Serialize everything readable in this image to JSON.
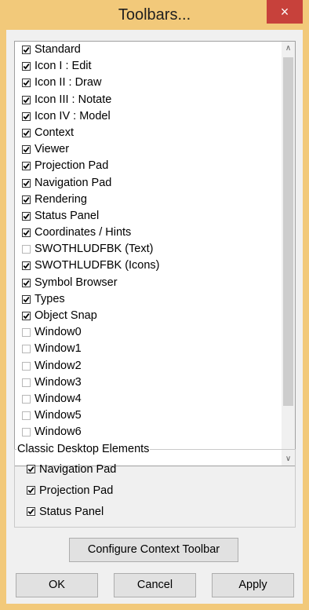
{
  "window": {
    "title": "Toolbars...",
    "close_glyph": "×"
  },
  "toolbars": {
    "items": [
      {
        "label": "Standard",
        "checked": true
      },
      {
        "label": "Icon I : Edit",
        "checked": true
      },
      {
        "label": "Icon II : Draw",
        "checked": true
      },
      {
        "label": "Icon III : Notate",
        "checked": true
      },
      {
        "label": "Icon IV : Model",
        "checked": true
      },
      {
        "label": "Context",
        "checked": true
      },
      {
        "label": "Viewer",
        "checked": true
      },
      {
        "label": "Projection Pad",
        "checked": true
      },
      {
        "label": "Navigation Pad",
        "checked": true
      },
      {
        "label": "Rendering",
        "checked": true
      },
      {
        "label": "Status Panel",
        "checked": true
      },
      {
        "label": "Coordinates / Hints",
        "checked": true
      },
      {
        "label": "SWOTHLUDFBK (Text)",
        "checked": false
      },
      {
        "label": "SWOTHLUDFBK (Icons)",
        "checked": true
      },
      {
        "label": "Symbol Browser",
        "checked": true
      },
      {
        "label": "Types",
        "checked": true
      },
      {
        "label": "Object Snap",
        "checked": true
      },
      {
        "label": "Window0",
        "checked": false
      },
      {
        "label": "Window1",
        "checked": false
      },
      {
        "label": "Window2",
        "checked": false
      },
      {
        "label": "Window3",
        "checked": false
      },
      {
        "label": "Window4",
        "checked": false
      },
      {
        "label": "Window5",
        "checked": false
      },
      {
        "label": "Window6",
        "checked": false
      }
    ],
    "scroll_up_glyph": "∧",
    "scroll_down_glyph": "∨"
  },
  "classic": {
    "legend": "Classic Desktop Elements",
    "items": [
      {
        "label": "Navigation Pad",
        "checked": true
      },
      {
        "label": "Projection Pad",
        "checked": true
      },
      {
        "label": "Status Panel",
        "checked": true
      }
    ]
  },
  "buttons": {
    "configure": "Configure Context Toolbar",
    "ok": "OK",
    "cancel": "Cancel",
    "apply": "Apply"
  },
  "colors": {
    "titlebar": "#f2c97a",
    "close": "#c7413b"
  }
}
